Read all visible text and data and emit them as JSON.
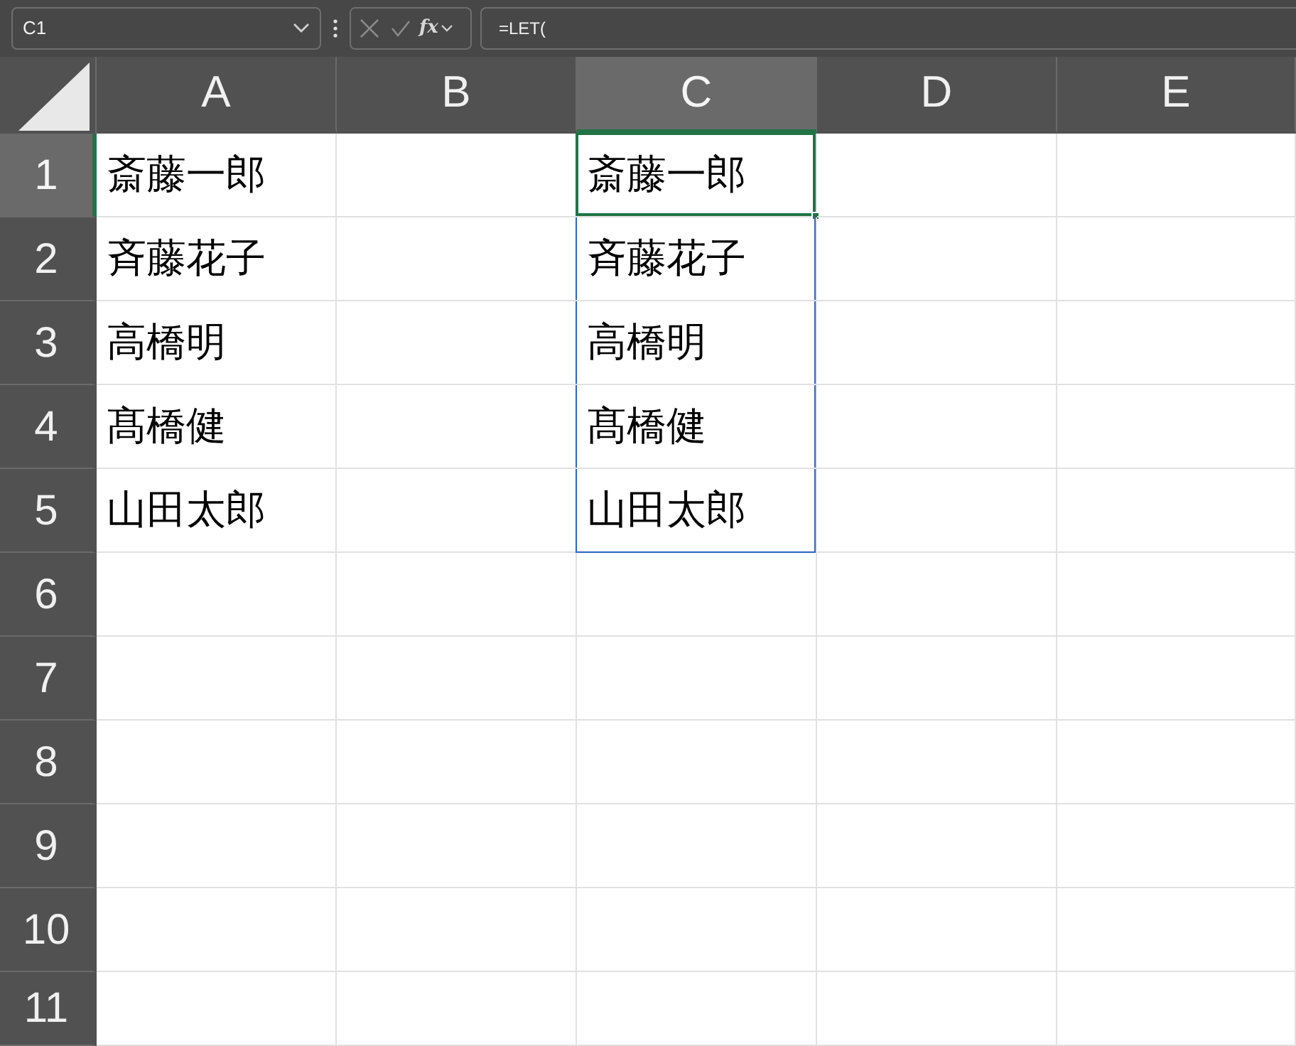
{
  "name_box": {
    "value": "C1"
  },
  "formula_bar": {
    "function_label": "fx",
    "value": "=LET("
  },
  "columns": [
    {
      "label": "A",
      "selected": false
    },
    {
      "label": "B",
      "selected": false
    },
    {
      "label": "C",
      "selected": true
    },
    {
      "label": "D",
      "selected": false
    },
    {
      "label": "E",
      "selected": false
    }
  ],
  "rows": [
    {
      "label": "1",
      "selected": true,
      "in_spill": true,
      "cells": {
        "A": "斎藤一郎",
        "C": "斎藤一郎"
      }
    },
    {
      "label": "2",
      "selected": false,
      "in_spill": true,
      "cells": {
        "A": "斉藤花子",
        "C": "斉藤花子"
      }
    },
    {
      "label": "3",
      "selected": false,
      "in_spill": true,
      "cells": {
        "A": "高橋明",
        "C": "高橋明"
      }
    },
    {
      "label": "4",
      "selected": false,
      "in_spill": true,
      "cells": {
        "A": "髙橋健",
        "C": "髙橋健"
      }
    },
    {
      "label": "5",
      "selected": false,
      "in_spill": true,
      "cells": {
        "A": "山田太郎",
        "C": "山田太郎"
      }
    },
    {
      "label": "6",
      "selected": false,
      "in_spill": false,
      "cells": {}
    },
    {
      "label": "7",
      "selected": false,
      "in_spill": false,
      "cells": {}
    },
    {
      "label": "8",
      "selected": false,
      "in_spill": false,
      "cells": {}
    },
    {
      "label": "9",
      "selected": false,
      "in_spill": false,
      "cells": {}
    },
    {
      "label": "10",
      "selected": false,
      "in_spill": false,
      "cells": {}
    },
    {
      "label": "11",
      "selected": false,
      "in_spill": false,
      "cells": {}
    }
  ]
}
